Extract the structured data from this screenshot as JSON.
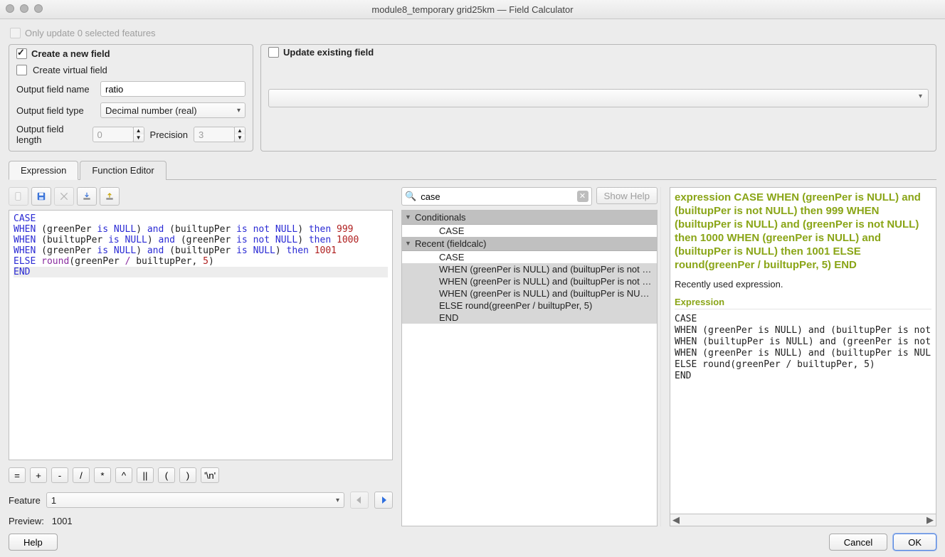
{
  "window": {
    "title": "module8_temporary grid25km — Field Calculator"
  },
  "top": {
    "only_update_label": "Only update 0 selected features",
    "create_new_label": "Create a new field",
    "update_existing_label": "Update existing field"
  },
  "newfield": {
    "virtual_label": "Create virtual field",
    "name_label": "Output field name",
    "name_value": "ratio",
    "type_label": "Output field type",
    "type_value": "Decimal number (real)",
    "length_label": "Output field length",
    "length_value": "0",
    "precision_label": "Precision",
    "precision_value": "3"
  },
  "tabs": {
    "expression": "Expression",
    "function_editor": "Function Editor"
  },
  "expr": {
    "lines_html": "<span class=\"kw\">CASE</span>\n<span class=\"kw\">WHEN</span> (greenPer <span class=\"kw\">is</span> <span class=\"kw\">NULL</span>) <span class=\"kw\">and</span> (builtupPer <span class=\"kw\">is</span> <span class=\"kw\">not</span> <span class=\"kw\">NULL</span>) <span class=\"kw\">then</span> <span class=\"num\">999</span>\n<span class=\"kw\">WHEN</span> (builtupPer <span class=\"kw\">is</span> <span class=\"kw\">NULL</span>) <span class=\"kw\">and</span> (greenPer <span class=\"kw\">is</span> <span class=\"kw\">not</span> <span class=\"kw\">NULL</span>) <span class=\"kw\">then</span> <span class=\"num\">1000</span>\n<span class=\"kw\">WHEN</span> (greenPer <span class=\"kw\">is</span> <span class=\"kw\">NULL</span>) <span class=\"kw\">and</span> (builtupPer <span class=\"kw\">is</span> <span class=\"kw\">NULL</span>) <span class=\"kw\">then</span> <span class=\"num\">1001</span>\n<span class=\"kw\">ELSE</span> <span class=\"op\">round</span>(greenPer <span class=\"op\">/</span> builtupPer, <span class=\"num\">5</span>)\n<span class=\"cursor-line\"><span class=\"kw\">END</span></span>"
  },
  "ops": [
    "=",
    "+",
    "-",
    "/",
    "*",
    "^",
    "||",
    "(",
    ")",
    "'\\n'"
  ],
  "feature": {
    "label": "Feature",
    "value": "1"
  },
  "preview": {
    "label": "Preview:",
    "value": "1001"
  },
  "search": {
    "value": "case",
    "show_help": "Show Help"
  },
  "tree": {
    "groups": [
      {
        "name": "Conditionals",
        "items": [
          "CASE"
        ]
      },
      {
        "name": "Recent (fieldcalc)",
        "items": [
          "CASE",
          "WHEN (greenPer is NULL) and (builtupPer is not …",
          "WHEN (greenPer is NULL) and (builtupPer is not …",
          "WHEN (greenPer is NULL) and (builtupPer is NUL…",
          "ELSE round(greenPer / builtupPer, 5)",
          "END"
        ]
      }
    ]
  },
  "help": {
    "title": "expression CASE WHEN (greenPer is NULL) and (builtupPer is not NULL) then 999 WHEN (builtupPer is NULL) and (greenPer is not NULL) then 1000 WHEN (greenPer is NULL) and (builtupPer is NULL) then 1001 ELSE round(greenPer / builtupPer, 5) END",
    "recently": "Recently used expression.",
    "heading": "Expression",
    "body": "CASE\nWHEN (greenPer is NULL) and (builtupPer is not\nWHEN (builtupPer is NULL) and (greenPer is not\nWHEN (greenPer is NULL) and (builtupPer is NUL\nELSE round(greenPer / builtupPer, 5)\nEND"
  },
  "footer": {
    "help": "Help",
    "cancel": "Cancel",
    "ok": "OK"
  }
}
